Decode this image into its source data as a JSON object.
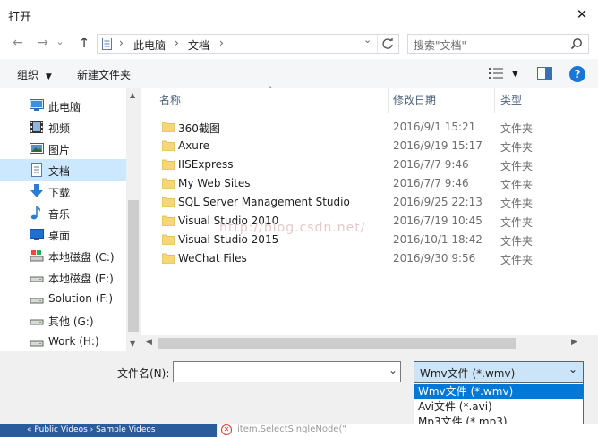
{
  "window": {
    "title": "打开",
    "close_glyph": "✕"
  },
  "nav": {
    "back_glyph": "←",
    "forward_glyph": "→",
    "dropdown_glyph": "⌄",
    "up_glyph": "↑",
    "breadcrumb": [
      {
        "label": "此电脑"
      },
      {
        "label": "文档"
      }
    ],
    "separator": "›",
    "search_placeholder": "搜索\"文档\""
  },
  "toolbar": {
    "organize": "组织",
    "new_folder": "新建文件夹"
  },
  "sidebar": {
    "items": [
      {
        "label": "此电脑",
        "icon": "computer-icon"
      },
      {
        "label": "视频",
        "icon": "video-icon"
      },
      {
        "label": "图片",
        "icon": "pictures-icon"
      },
      {
        "label": "文档",
        "icon": "documents-icon",
        "selected": true
      },
      {
        "label": "下载",
        "icon": "download-icon"
      },
      {
        "label": "音乐",
        "icon": "music-icon"
      },
      {
        "label": "桌面",
        "icon": "desktop-icon"
      },
      {
        "label": "本地磁盘 (C:)",
        "icon": "drive-icon"
      },
      {
        "label": "本地磁盘 (E:)",
        "icon": "drive-icon"
      },
      {
        "label": "Solution (F:)",
        "icon": "drive-icon"
      },
      {
        "label": "其他 (G:)",
        "icon": "drive-icon"
      },
      {
        "label": "Work (H:)",
        "icon": "drive-icon"
      }
    ]
  },
  "columns": {
    "name": "名称",
    "date": "修改日期",
    "type": "类型"
  },
  "files": [
    {
      "name": "360截图",
      "date": "2016/9/1 15:21",
      "type": "文件夹"
    },
    {
      "name": "Axure",
      "date": "2016/9/19 15:17",
      "type": "文件夹"
    },
    {
      "name": "IISExpress",
      "date": "2016/7/7 9:46",
      "type": "文件夹"
    },
    {
      "name": "My Web Sites",
      "date": "2016/7/7 9:46",
      "type": "文件夹"
    },
    {
      "name": "SQL Server Management Studio",
      "date": "2016/9/25 22:13",
      "type": "文件夹"
    },
    {
      "name": "Visual Studio 2010",
      "date": "2016/7/19 10:45",
      "type": "文件夹"
    },
    {
      "name": "Visual Studio 2015",
      "date": "2016/10/1 18:42",
      "type": "文件夹"
    },
    {
      "name": "WeChat Files",
      "date": "2016/9/30 9:56",
      "type": "文件夹"
    }
  ],
  "watermark": "http://blog.csdn.net/",
  "footer": {
    "filename_label": "文件名(N):",
    "filetype_selected": "Wmv文件 (*.wmv)",
    "filetype_options": [
      "Wmv文件 (*.wmv)",
      "Avi文件 (*.avi)",
      "Mp3文件 (*.mp3)"
    ]
  },
  "background": {
    "crumb": "« Public Videos › Sample Videos",
    "code": "item.SelectSingleNode(\""
  },
  "colors": {
    "accent": "#0078d7",
    "selection": "#cce8ff",
    "folder": "#f7d774"
  }
}
